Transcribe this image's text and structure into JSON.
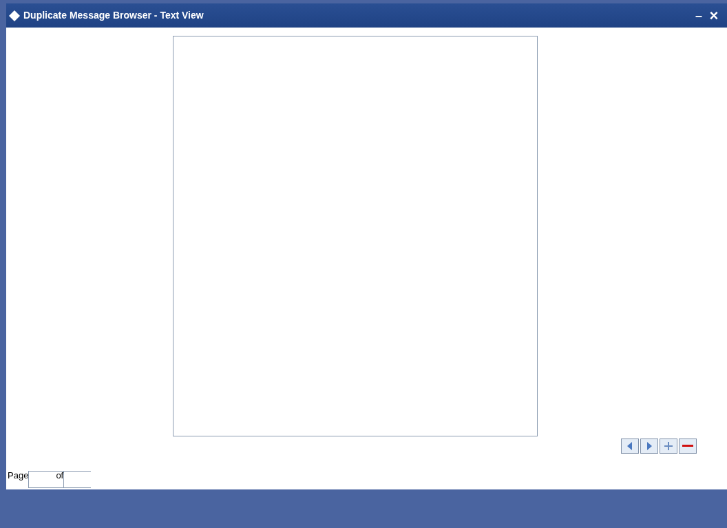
{
  "window": {
    "title": "Duplicate Message Browser - Text View"
  },
  "title_controls": [
    "–",
    "×"
  ],
  "pager": {
    "page_label": "Page",
    "of_label": "of"
  }
}
